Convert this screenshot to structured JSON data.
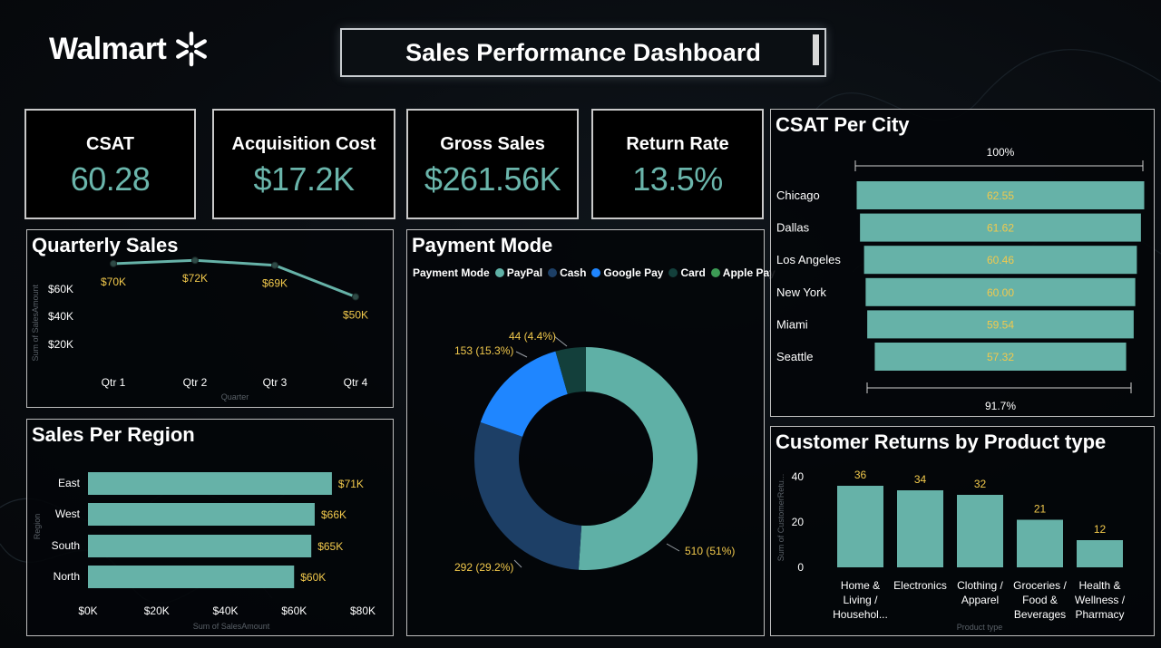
{
  "brand": {
    "name": "Walmart",
    "spark_icon": "spark-icon"
  },
  "title": "Sales Performance Dashboard",
  "kpis": [
    {
      "label": "CSAT",
      "value": "60.28"
    },
    {
      "label": "Acquisition Cost",
      "value": "$17.2K"
    },
    {
      "label": "Gross Sales",
      "value": "$261.56K"
    },
    {
      "label": "Return Rate",
      "value": "13.5%"
    }
  ],
  "colors": {
    "teal": "#66b2a8",
    "value_text": "#6ab5ab",
    "label_yellow": "#f2c94c",
    "cash": "#1d3f66",
    "paypal": "#5fb0a6",
    "google_pay": "#1f86ff",
    "card": "#133f3b",
    "apple_pay": "#3d9c55"
  },
  "quarterly": {
    "title": "Quarterly Sales",
    "ylabel": "Sum of SalesAmount",
    "xlabel": "Quarter",
    "yticks": [
      "$60K",
      "$40K",
      "$20K"
    ],
    "chart_data": {
      "type": "line",
      "x": [
        "Qtr 1",
        "Qtr 2",
        "Qtr 3",
        "Qtr 4"
      ],
      "values": [
        70,
        72,
        69,
        50
      ],
      "labels": [
        "$70K",
        "$72K",
        "$69K",
        "$50K"
      ],
      "ylim": [
        0,
        75
      ]
    }
  },
  "region": {
    "title": "Sales Per Region",
    "ylabel": "Region",
    "xlabel": "Sum of SalesAmount",
    "xticks": [
      "$0K",
      "$20K",
      "$40K",
      "$60K",
      "$80K"
    ],
    "chart_data": {
      "type": "bar",
      "categories": [
        "East",
        "West",
        "South",
        "North"
      ],
      "values": [
        71,
        66,
        65,
        60
      ],
      "labels": [
        "$71K",
        "$66K",
        "$65K",
        "$60K"
      ],
      "xlim": [
        0,
        80
      ]
    }
  },
  "payment": {
    "title": "Payment Mode",
    "legend_title": "Payment Mode",
    "legend": [
      "PayPal",
      "Cash",
      "Google Pay",
      "Card",
      "Apple Pay"
    ],
    "chart_data": {
      "type": "pie",
      "slices": [
        {
          "name": "PayPal",
          "value": 510,
          "label": "510 (51%)"
        },
        {
          "name": "Cash",
          "value": 292,
          "label": "292 (29.2%)"
        },
        {
          "name": "Google Pay",
          "value": 153,
          "label": "153 (15.3%)"
        },
        {
          "name": "Card",
          "value": 44,
          "label": "44 (4.4%)"
        }
      ]
    }
  },
  "csat_city": {
    "title": "CSAT Per City",
    "top_label": "100%",
    "bottom_label": "91.7%",
    "chart_data": {
      "type": "bar",
      "categories": [
        "Chicago",
        "Dallas",
        "Los Angeles",
        "New York",
        "Miami",
        "Seattle"
      ],
      "values": [
        62.55,
        61.62,
        60.46,
        60.0,
        59.54,
        57.32
      ],
      "labels": [
        "62.55",
        "61.62",
        "60.46",
        "60.00",
        "59.54",
        "57.32"
      ]
    }
  },
  "returns": {
    "title": "Customer Returns by Product type",
    "ylabel": "Sum of CustomerRetu...",
    "xlabel": "Product type",
    "yticks": [
      "40",
      "20",
      "0"
    ],
    "chart_data": {
      "type": "bar",
      "categories": [
        [
          "Home &",
          "Living /",
          "Househol..."
        ],
        [
          "Electronics"
        ],
        [
          "Clothing /",
          "Apparel"
        ],
        [
          "Groceries /",
          "Food &",
          "Beverages"
        ],
        [
          "Health &",
          "Wellness /",
          "Pharmacy"
        ]
      ],
      "values": [
        36,
        34,
        32,
        21,
        12
      ],
      "labels": [
        "36",
        "34",
        "32",
        "21",
        "12"
      ],
      "ylim": [
        0,
        40
      ]
    }
  }
}
